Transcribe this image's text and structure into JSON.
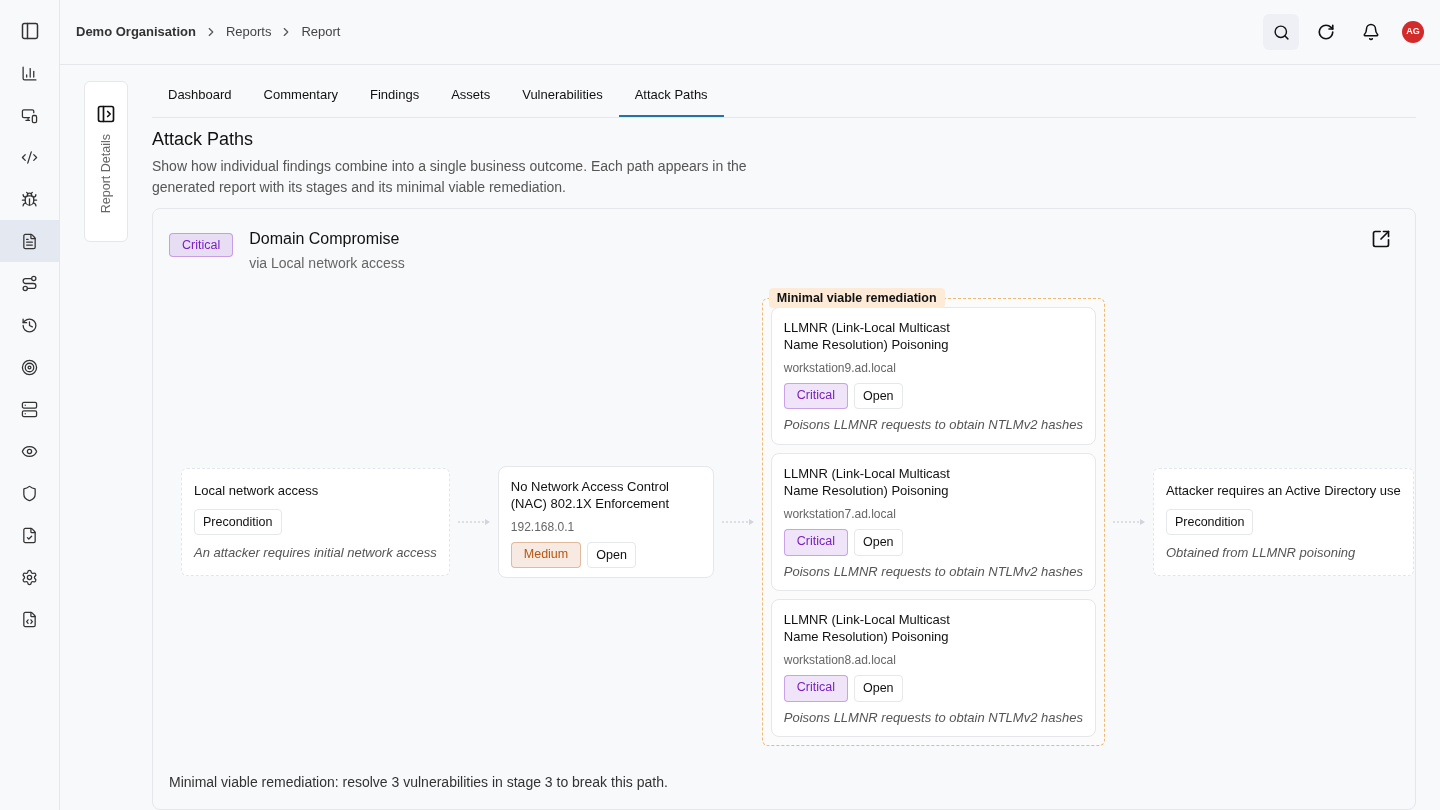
{
  "sidebar": {
    "items": [
      {
        "selected": false
      },
      {
        "selected": false
      },
      {
        "selected": false
      },
      {
        "selected": false
      },
      {
        "selected": false
      },
      {
        "selected": true
      },
      {
        "selected": false
      },
      {
        "selected": false
      },
      {
        "selected": false
      },
      {
        "selected": false
      },
      {
        "selected": false
      },
      {
        "selected": false
      },
      {
        "selected": false
      },
      {
        "selected": false
      },
      {
        "selected": false
      }
    ]
  },
  "breadcrumb": [
    "Demo Organisation",
    "Reports",
    "Report"
  ],
  "user": {
    "initials": "AG"
  },
  "side_tab": {
    "label": "Report Details"
  },
  "tabs": [
    {
      "label": "Dashboard",
      "selected": false
    },
    {
      "label": "Commentary",
      "selected": false
    },
    {
      "label": "Findings",
      "selected": false
    },
    {
      "label": "Assets",
      "selected": false
    },
    {
      "label": "Vulnerabilities",
      "selected": false
    },
    {
      "label": "Attack Paths",
      "selected": true
    }
  ],
  "page": {
    "title": "Attack Paths",
    "description": "Show how individual findings combine into a single business outcome. Each path appears in the generated report with its stages and its minimal viable remediation."
  },
  "path": {
    "severity": {
      "label": "Critical",
      "color": "#7a1fc2"
    },
    "title": "Domain Compromise",
    "subtitle": "via Local network access",
    "stages": [
      {
        "remediation": false,
        "nodes": [
          {
            "kind": "precondition",
            "title": "Local network access",
            "tag": "Precondition",
            "note": "An attacker requires initial network access"
          }
        ]
      },
      {
        "remediation": false,
        "nodes": [
          {
            "kind": "finding",
            "title": "No Network Access Control (NAC) 802.1X Enforcement",
            "host": "192.168.0.1",
            "severity": {
              "label": "Medium",
              "color": "#b8560f"
            },
            "status": "Open"
          }
        ]
      },
      {
        "remediation": true,
        "label": "Minimal viable remediation",
        "nodes": [
          {
            "kind": "finding",
            "title": "LLMNR (Link-Local Multicast Name Resolution) Poisoning",
            "host": "workstation9.ad.local",
            "severity": {
              "label": "Critical",
              "color": "#7a1fc2"
            },
            "status": "Open",
            "note": "Poisons LLMNR requests to obtain NTLMv2 hashes"
          },
          {
            "kind": "finding",
            "title": "LLMNR (Link-Local Multicast Name Resolution) Poisoning",
            "host": "workstation7.ad.local",
            "severity": {
              "label": "Critical",
              "color": "#7a1fc2"
            },
            "status": "Open",
            "note": "Poisons LLMNR requests to obtain NTLMv2 hashes"
          },
          {
            "kind": "finding",
            "title": "LLMNR (Link-Local Multicast Name Resolution) Poisoning",
            "host": "workstation8.ad.local",
            "severity": {
              "label": "Critical",
              "color": "#7a1fc2"
            },
            "status": "Open",
            "note": "Poisons LLMNR requests to obtain NTLMv2 hashes"
          }
        ]
      },
      {
        "remediation": false,
        "nodes": [
          {
            "kind": "precondition",
            "title": "Attacker requires an Active Directory use",
            "tag": "Precondition",
            "note": "Obtained from LLMNR poisoning"
          }
        ]
      }
    ],
    "summary": "Minimal viable remediation: resolve 3 vulnerabilities in stage 3 to break this path."
  }
}
